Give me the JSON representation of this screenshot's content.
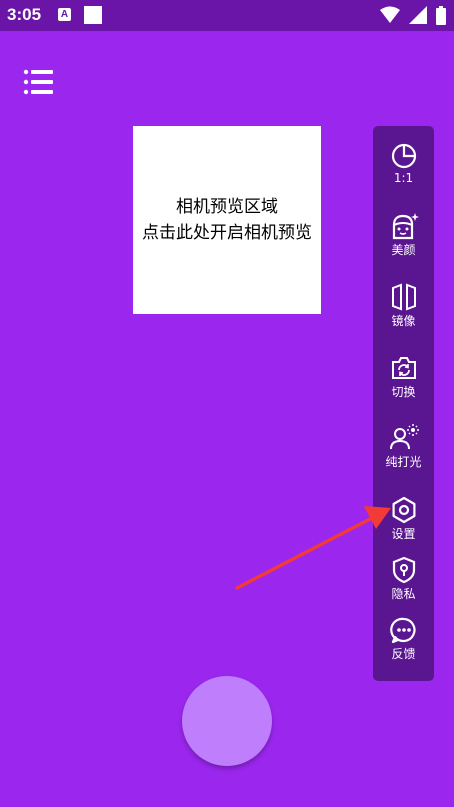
{
  "status_bar": {
    "time": "3:05",
    "notif_letter": "A"
  },
  "preview": {
    "line1": "相机预览区域",
    "line2": "点击此处开启相机预览"
  },
  "toolbar": {
    "items": [
      {
        "label": "1:1",
        "icon": "aspect-ratio-icon"
      },
      {
        "label": "美颜",
        "icon": "beauty-icon"
      },
      {
        "label": "镜像",
        "icon": "mirror-icon"
      },
      {
        "label": "切换",
        "icon": "switch-camera-icon"
      },
      {
        "label": "纯打光",
        "icon": "fill-light-icon"
      },
      {
        "label": "设置",
        "icon": "gear-icon"
      },
      {
        "label": "隐私",
        "icon": "privacy-shield-icon"
      },
      {
        "label": "反馈",
        "icon": "feedback-icon"
      }
    ]
  },
  "colors": {
    "background": "#9b27ee",
    "status_bar": "#6a14a8",
    "toolbar": "#5a1690",
    "shutter": "#bf7efc",
    "arrow": "#f23a36"
  }
}
